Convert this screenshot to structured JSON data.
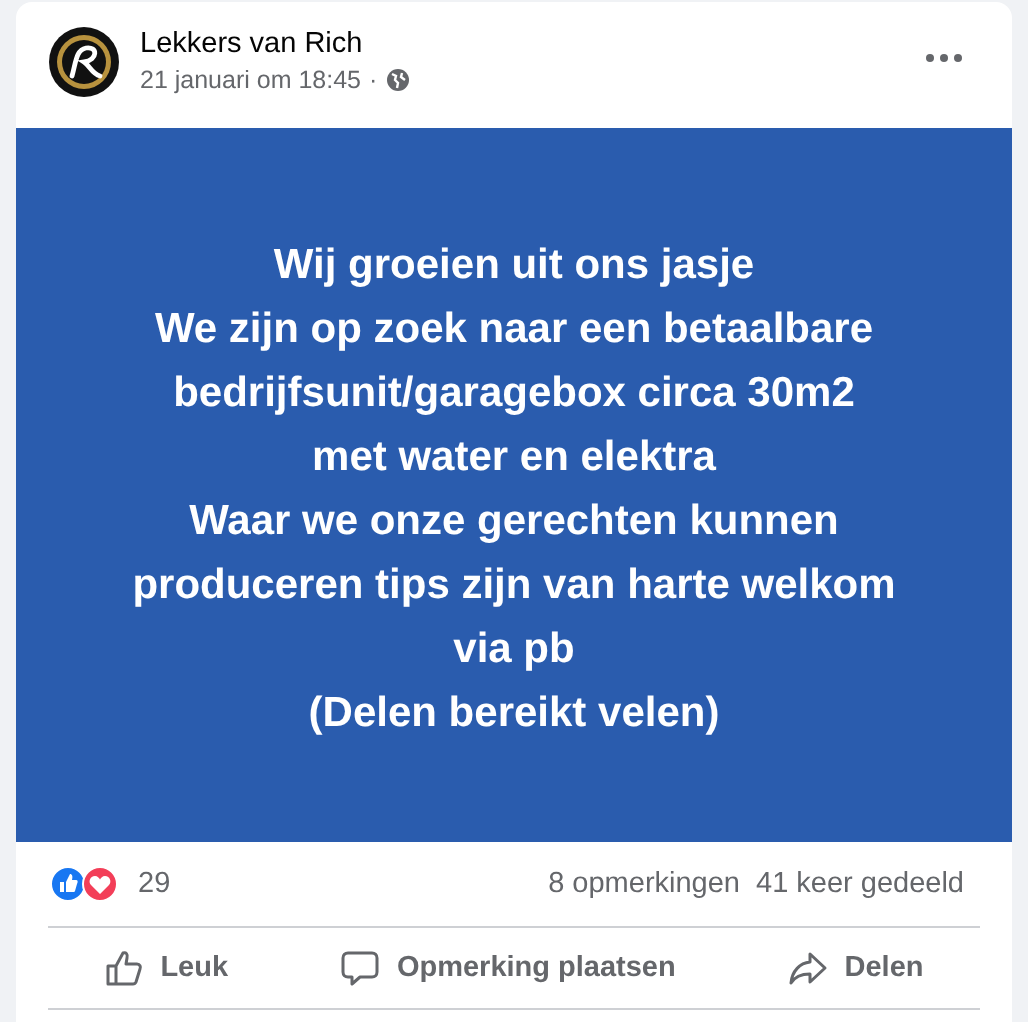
{
  "post": {
    "author": "Lekkers van Rich",
    "timestamp": "21 januari om 18:45",
    "separator": "·",
    "text_lines": [
      "Wij groeien uit ons jasje",
      "We zijn op zoek naar een betaalbare",
      "bedrijfsunit/garagebox circa 30m2",
      "met water en elektra",
      "Waar we onze gerechten kunnen",
      "produceren tips zijn van harte welkom",
      "via pb",
      "(Delen bereikt velen)"
    ]
  },
  "stats": {
    "reaction_count": "29",
    "comments": "8 opmerkingen",
    "shares": "41 keer gedeeld"
  },
  "actions": [
    {
      "kind": "like",
      "label": "Leuk"
    },
    {
      "kind": "comment",
      "label": "Opmerking plaatsen"
    },
    {
      "kind": "share",
      "label": "Delen"
    }
  ]
}
